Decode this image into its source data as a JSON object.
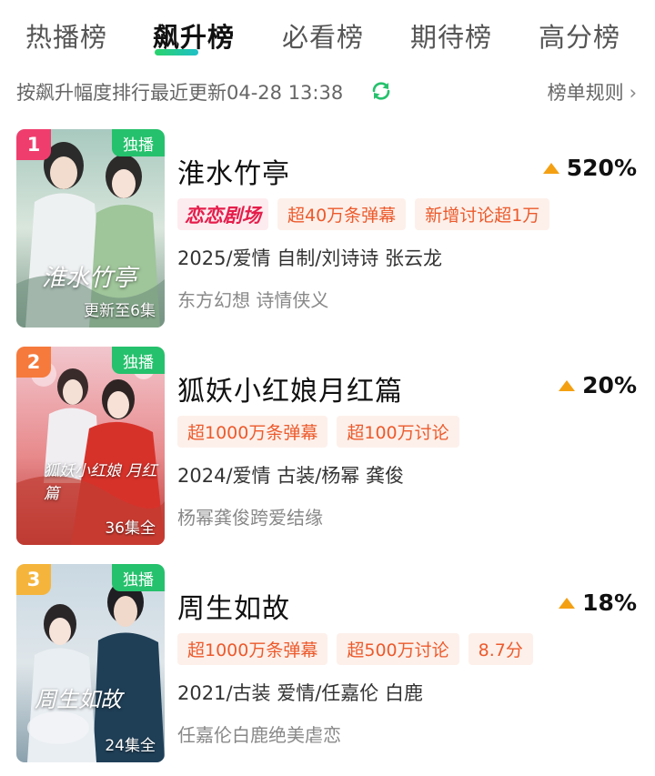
{
  "tabs": [
    {
      "label": "热播榜",
      "active": false
    },
    {
      "label": "飙升榜",
      "active": true
    },
    {
      "label": "必看榜",
      "active": false
    },
    {
      "label": "期待榜",
      "active": false
    },
    {
      "label": "高分榜",
      "active": false
    }
  ],
  "subheader": {
    "text": "按飙升幅度排行最近更新04-28 13:38",
    "refresh_icon": "refresh-icon",
    "rules_label": "榜单规则",
    "rules_icon": "chevron-right-icon"
  },
  "colors": {
    "accent_green": "#25c16c",
    "tag_text": "#ec5a2c",
    "tag_bg": "#fdf0ea",
    "trend_arrow": "#f4a013"
  },
  "items": [
    {
      "rank": "1",
      "rank_color": "#ef3e6e",
      "badge": "独播",
      "poster_title": "淮水竹亭",
      "episodes": "更新至6集",
      "title": "淮水竹亭",
      "trend": "520%",
      "logo_tag": "恋恋剧场",
      "tags": [
        "超40万条弹幕",
        "新增讨论超1万"
      ],
      "meta": "2025/爱情 自制/刘诗诗 张云龙",
      "description": "东方幻想 诗情侠义"
    },
    {
      "rank": "2",
      "rank_color": "#f57a3c",
      "badge": "独播",
      "poster_title": "狐妖小红娘 月红篇",
      "episodes": "36集全",
      "title": "狐妖小红娘月红篇",
      "trend": "20%",
      "tags": [
        "超1000万条弹幕",
        "超100万讨论"
      ],
      "meta": "2024/爱情 古装/杨幂 龚俊",
      "description": "杨幂龚俊跨爱结缘"
    },
    {
      "rank": "3",
      "rank_color": "#f5b53c",
      "badge": "独播",
      "poster_title": "周生如故",
      "episodes": "24集全",
      "title": "周生如故",
      "trend": "18%",
      "tags": [
        "超1000万条弹幕",
        "超500万讨论",
        "8.7分"
      ],
      "meta": "2021/古装 爱情/任嘉伦 白鹿",
      "description": "任嘉伦白鹿绝美虐恋"
    }
  ]
}
